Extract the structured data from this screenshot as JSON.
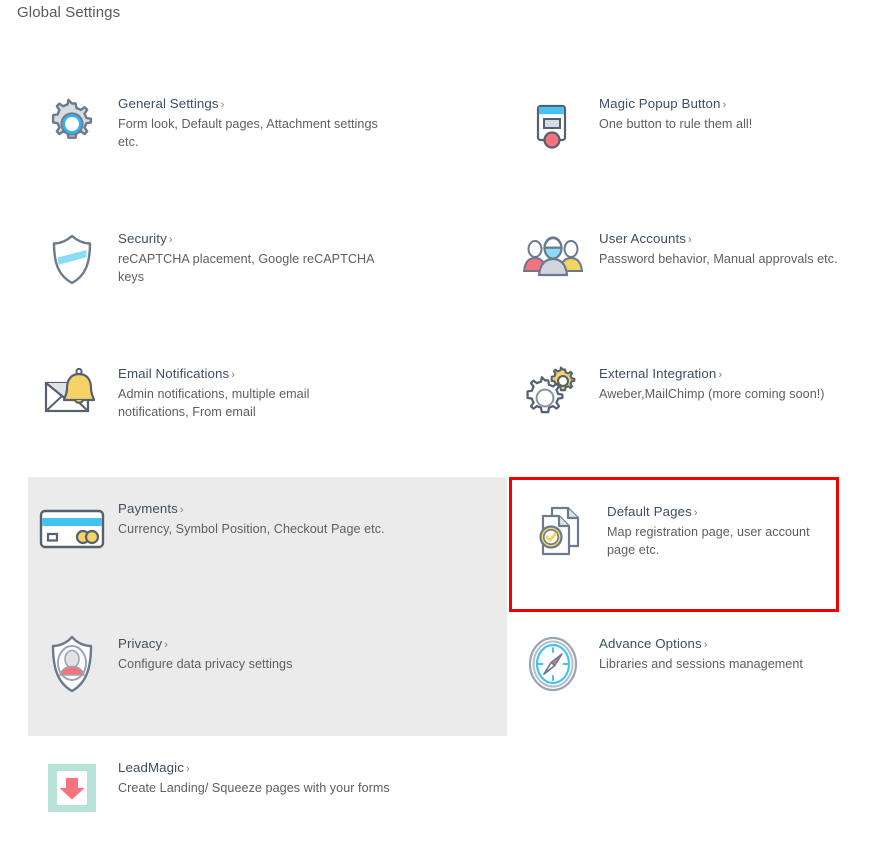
{
  "page": {
    "title": "Global Settings",
    "chevron": "›"
  },
  "colors": {
    "title_text": "#5a5a5a",
    "item_title": "#3d4f63",
    "item_desc": "#5e5e5e",
    "shaded_row": "#ebebeb",
    "highlight_border": "#f40000",
    "accent_blue": "#29b6f6",
    "accent_yellow": "#f6d365",
    "accent_red": "#f4737d",
    "icon_outline": "#4a5568",
    "background": "#ffffff"
  },
  "items": [
    {
      "id": "general-settings",
      "icon": "gear-icon",
      "title": "General Settings",
      "desc": "Form look, Default pages, Attachment settings etc.",
      "column": "left",
      "shaded": false,
      "highlighted": false
    },
    {
      "id": "magic-popup-button",
      "icon": "popup-button-icon",
      "title": "Magic Popup Button",
      "desc": "One button to rule them all!",
      "column": "right",
      "shaded": false,
      "highlighted": false
    },
    {
      "id": "security",
      "icon": "shield-icon",
      "title": "Security",
      "desc": "reCAPTCHA placement, Google reCAPTCHA keys",
      "column": "left",
      "shaded": false,
      "highlighted": false
    },
    {
      "id": "user-accounts",
      "icon": "users-icon",
      "title": "User Accounts",
      "desc": "Password behavior, Manual approvals etc.",
      "column": "right",
      "shaded": false,
      "highlighted": false
    },
    {
      "id": "email-notifications",
      "icon": "envelope-bell-icon",
      "title": "Email Notifications",
      "desc": "Admin notifications, multiple email notifications, From email",
      "column": "left",
      "shaded": false,
      "highlighted": false
    },
    {
      "id": "external-integration",
      "icon": "gears-icon",
      "title": "External Integration",
      "desc": "Aweber,MailChimp (more coming soon!)",
      "column": "right",
      "shaded": false,
      "highlighted": false
    },
    {
      "id": "payments",
      "icon": "credit-card-icon",
      "title": "Payments",
      "desc": "Currency, Symbol Position, Checkout Page etc.",
      "column": "left",
      "shaded": true,
      "highlighted": false
    },
    {
      "id": "default-pages",
      "icon": "documents-check-icon",
      "title": "Default Pages",
      "desc": "Map registration page, user account page etc.",
      "column": "right",
      "shaded": false,
      "highlighted": true
    },
    {
      "id": "privacy",
      "icon": "shield-person-icon",
      "title": "Privacy",
      "desc": "Configure data privacy settings",
      "column": "left",
      "shaded": true,
      "highlighted": false
    },
    {
      "id": "advance-options",
      "icon": "compass-icon",
      "title": "Advance Options",
      "desc": "Libraries and sessions management",
      "column": "right",
      "shaded": false,
      "highlighted": false
    },
    {
      "id": "leadmagic",
      "icon": "download-page-icon",
      "title": "LeadMagic",
      "desc": "Create Landing/ Squeeze pages with your forms",
      "column": "left",
      "shaded": false,
      "highlighted": false
    }
  ]
}
